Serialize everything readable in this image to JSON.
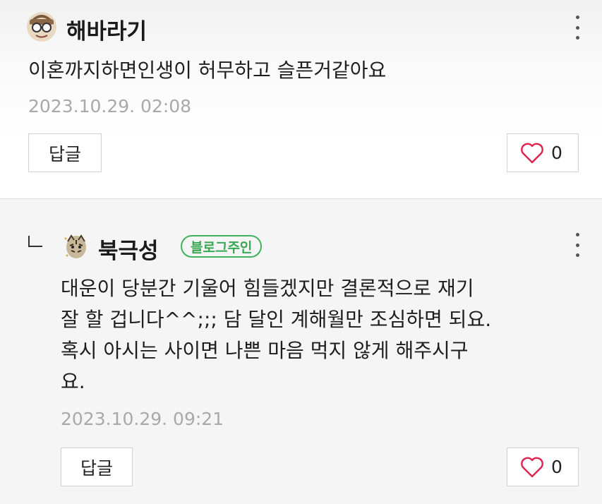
{
  "comments": [
    {
      "author": "해바라기",
      "avatar_icon": "glasses-face-avatar",
      "text_lines": [
        "이혼까지하면인생이 허무하고 슬픈거같아요"
      ],
      "timestamp": "2023.10.29. 02:08",
      "reply_label": "답글",
      "like_count": "0"
    },
    {
      "author": "북극성",
      "avatar_icon": "tiger-avatar",
      "badge": "블로그주인",
      "text_lines": [
        "대운이 당분간 기울어 힘들겠지만 결론적으로 재기",
        "잘 할 겁니다^^;;; 담 달인 계해월만 조심하면 되요.",
        "혹시 아시는 사이면 나쁜 마음 먹지 않게 해주시구",
        "요."
      ],
      "timestamp": "2023.10.29. 09:21",
      "reply_label": "답글",
      "like_count": "0"
    }
  ],
  "colors": {
    "badge_green": "#40b25c",
    "heart_red": "#e0224e",
    "timestamp_gray": "#a9a9a9"
  }
}
